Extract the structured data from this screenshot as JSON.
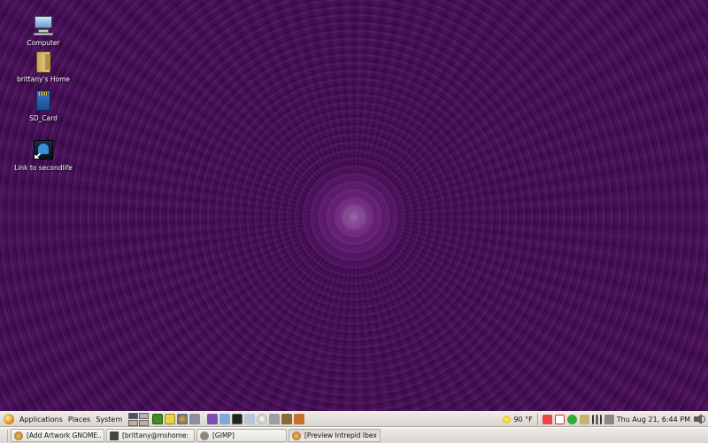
{
  "desktop": {
    "icons": [
      {
        "label": "Computer",
        "icon": "computer-icon"
      },
      {
        "label": "brittany's Home",
        "icon": "home-folder-icon"
      },
      {
        "label": "SD_Card",
        "icon": "sd-card-icon"
      },
      {
        "label": "Link to secondlife",
        "icon": "secondlife-icon"
      }
    ]
  },
  "panel": {
    "menus": [
      "Applications",
      "Places",
      "System"
    ],
    "weather": "90 °F",
    "clock": "Thu Aug 21,  6:44 PM"
  },
  "taskbar": {
    "tasks": [
      {
        "label": "[Add Artwork GNOME..."
      },
      {
        "label": "[brittany@mshome: ..."
      },
      {
        "label": "[GIMP]"
      },
      {
        "label": "[Preview Intrepid Ibex..."
      }
    ]
  },
  "colors": {
    "wallpaper": "#3d0a4a",
    "panel": "#e6e2dd",
    "launcher_green": "#4a9a2a",
    "launcher_purple": "#7a4fb0"
  }
}
